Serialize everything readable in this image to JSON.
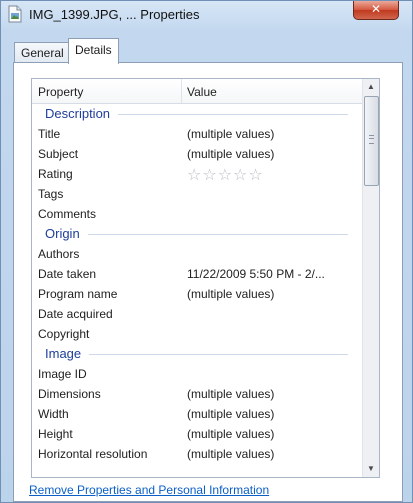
{
  "window": {
    "title": "IMG_1399.JPG, ... Properties",
    "close_label": "✕"
  },
  "tabs": [
    {
      "label": "General",
      "selected": false
    },
    {
      "label": "Details",
      "selected": true
    }
  ],
  "details": {
    "header": {
      "property": "Property",
      "value": "Value"
    },
    "groups": [
      {
        "label": "Description",
        "rows": [
          {
            "property": "Title",
            "value": "(multiple values)"
          },
          {
            "property": "Subject",
            "value": "(multiple values)"
          },
          {
            "property": "Rating",
            "value": "",
            "stars": 0,
            "stars_max": 5
          },
          {
            "property": "Tags",
            "value": ""
          },
          {
            "property": "Comments",
            "value": ""
          }
        ]
      },
      {
        "label": "Origin",
        "rows": [
          {
            "property": "Authors",
            "value": ""
          },
          {
            "property": "Date taken",
            "value": "11/22/2009 5:50 PM - 2/..."
          },
          {
            "property": "Program name",
            "value": "(multiple values)"
          },
          {
            "property": "Date acquired",
            "value": ""
          },
          {
            "property": "Copyright",
            "value": ""
          }
        ]
      },
      {
        "label": "Image",
        "rows": [
          {
            "property": "Image ID",
            "value": ""
          },
          {
            "property": "Dimensions",
            "value": "(multiple values)"
          },
          {
            "property": "Width",
            "value": "(multiple values)"
          },
          {
            "property": "Height",
            "value": "(multiple values)"
          },
          {
            "property": "Horizontal resolution",
            "value": "(multiple values)"
          }
        ]
      }
    ]
  },
  "footer": {
    "link": "Remove Properties and Personal Information"
  },
  "scrollbar": {
    "up_icon": "▲",
    "down_icon": "▼"
  }
}
